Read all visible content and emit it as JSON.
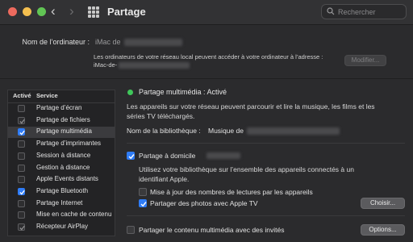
{
  "window": {
    "title": "Partage",
    "search_placeholder": "Rechercher"
  },
  "computer_name": {
    "label": "Nom de l’ordinateur :",
    "value_prefix": "iMac de",
    "info_line1": "Les ordinateurs de votre réseau local peuvent accéder à votre ordinateur à l’adresse :",
    "info_line2": "iMac-de-",
    "edit_button": "Modifier..."
  },
  "services": {
    "header_active": "Activé",
    "header_service": "Service",
    "items": [
      {
        "label": "Partage d’écran",
        "state": "off"
      },
      {
        "label": "Partage de fichiers",
        "state": "gray"
      },
      {
        "label": "Partage multimédia",
        "state": "on"
      },
      {
        "label": "Partage d’imprimantes",
        "state": "off"
      },
      {
        "label": "Session à distance",
        "state": "off"
      },
      {
        "label": "Gestion à distance",
        "state": "off"
      },
      {
        "label": "Apple Events distants",
        "state": "off"
      },
      {
        "label": "Partage Bluetooth",
        "state": "on"
      },
      {
        "label": "Partage Internet",
        "state": "off"
      },
      {
        "label": "Mise en cache de contenu",
        "state": "off"
      },
      {
        "label": "Récepteur AirPlay",
        "state": "gray"
      }
    ]
  },
  "detail": {
    "status": "Partage multimédia : Activé",
    "description_line1": "Les appareils sur votre réseau peuvent parcourir et lire la musique, les films et les",
    "description_line2": "séries TV téléchargés.",
    "library_label": "Nom de la bibliothèque :",
    "library_value": "Musique de",
    "home_sharing_label": "Partage à domicile",
    "home_desc_line1": "Utilisez votre bibliothèque sur l’ensemble des appareils connectés à un",
    "home_desc_line2": "identifiant Apple.",
    "update_play_counts": "Mise à jour des nombres de lectures par les appareils",
    "share_photos": "Partager des photos avec Apple TV",
    "choose_button": "Choisir...",
    "guests_label": "Partager le contenu multimédia avec des invités",
    "options_button": "Options..."
  }
}
